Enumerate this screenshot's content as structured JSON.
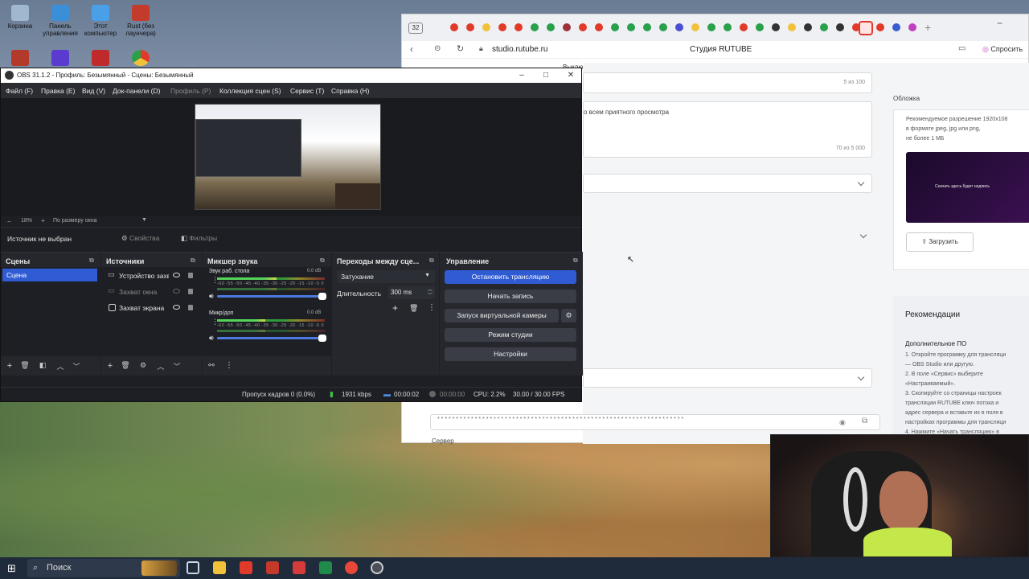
{
  "desktop": {
    "icons": [
      {
        "label": "Корзина",
        "color": "#9fb8d0"
      },
      {
        "label": "Панель управления",
        "color": "#3b8fd8"
      },
      {
        "label": "Этот компьютер",
        "color": "#4aa0e6"
      },
      {
        "label": "Rust (без лаунчера)",
        "color": "#c23b2b"
      },
      {
        "label": "",
        "color": "#b33a2a"
      },
      {
        "label": "",
        "color": "#5b3ad0"
      },
      {
        "label": "",
        "color": "#c12a2a"
      },
      {
        "label": "",
        "color": "#e0a21f"
      }
    ]
  },
  "browser": {
    "tab_count_badge": "32",
    "url": "studio.rutube.ru",
    "page_title": "Студия RUTUBE",
    "action_label": "Спросить",
    "tooltip_fragment": "Выключить",
    "page": {
      "counter_1": "5 из 100",
      "description_snippet": "о всем приятного просмотра",
      "counter_2": "70 из 5 000",
      "cover_label": "Обложка",
      "cover_hint_lines": [
        "Рекомендуемое разрешение 1920x108",
        "в формате jpeg, jpg или png,",
        "не более 1 МБ"
      ],
      "cover_preview_text": "Скачать здесь будет надпись",
      "upload_button": "Загрузить",
      "recommendations_title": "Рекомендации",
      "additional_po": "Дополнительное ПО",
      "steps": [
        "1. Откройте программу для трансляци",
        "— OBS Studio или другую.",
        "2. В поле «Сервис» выберите",
        "«Настраиваемый».",
        "3. Скопируйте со страницы настроек",
        "трансляции RUTUBE ключ потока и",
        "адрес сервера и вставьте их в поля в",
        "настройках программы для трансляци",
        "4. Нажмите «Начать трансляцию» в"
      ],
      "stream_key_mask": "* * * * * * * * * * * * * * * * * * * * * * * * * * * * * * * * * * * * * * * * * * * * * * * * * * * * * * * * * * * * * * * * * *",
      "server_label": "Сервер"
    }
  },
  "obs": {
    "title": "OBS 31.1.2 - Профиль: Безымянный - Сцены: Безымянный",
    "menu": [
      "Файл (F)",
      "Правка (E)",
      "Вид (V)",
      "Док-панели (D)",
      "Профиль (P)",
      "Коллекция сцен (S)",
      "Сервис (T)",
      "Справка (H)"
    ],
    "zoom": {
      "minus": "−",
      "level": "18%",
      "plus": "+",
      "fit_label": "По размеру окна"
    },
    "source_bar": {
      "no_source": "Источник не выбран",
      "properties": "Свойства",
      "filters": "Фильтры"
    },
    "scenes": {
      "title": "Сцены",
      "items": [
        "Сцена"
      ]
    },
    "sources": {
      "title": "Источники",
      "items": [
        "Устройство захв",
        "Захват окна",
        "Захват экрана"
      ]
    },
    "mixer": {
      "title": "Микшер звука",
      "channels": [
        {
          "name": "Звук раб. стола",
          "db": "0.0 dB",
          "level": 0.55
        },
        {
          "name": "Микр/доп",
          "db": "0.0 dB",
          "level": 0.45
        }
      ],
      "scale": "-60 -55 -50 -45 -40 -35 -30 -25 -20 -15 -10 -5 0"
    },
    "transitions": {
      "title": "Переходы между сце...",
      "selected": "Затухание",
      "duration_label": "Длительность",
      "duration_value": "300 ms"
    },
    "controls": {
      "title": "Управление",
      "stop_stream": "Остановить трансляцию",
      "start_record": "Начать запись",
      "virtual_cam": "Запуск виртуальной камеры",
      "studio_mode": "Режим студии",
      "settings": "Настройки"
    },
    "status": {
      "dropped": "Пропуск кадров 0 (0.0%)",
      "bitrate": "1931 kbps",
      "stream_time": "00:00:02",
      "rec_time": "00:00:00",
      "cpu": "CPU: 2.2%",
      "fps": "30.00 / 30.00 FPS"
    }
  },
  "taskbar": {
    "search_placeholder": "Поиск",
    "apps": [
      {
        "name": "task-view",
        "color": "#cfd6e0"
      },
      {
        "name": "explorer",
        "color": "#f0c23a"
      },
      {
        "name": "yandex",
        "color": "#e23a2a"
      },
      {
        "name": "rust",
        "color": "#c33a2a"
      },
      {
        "name": "word",
        "color": "#d63b3b"
      },
      {
        "name": "excel",
        "color": "#1f8a4a"
      },
      {
        "name": "yandex-browser",
        "color": "#e8473a"
      },
      {
        "name": "obs",
        "color": "#4a4f5a"
      }
    ]
  }
}
